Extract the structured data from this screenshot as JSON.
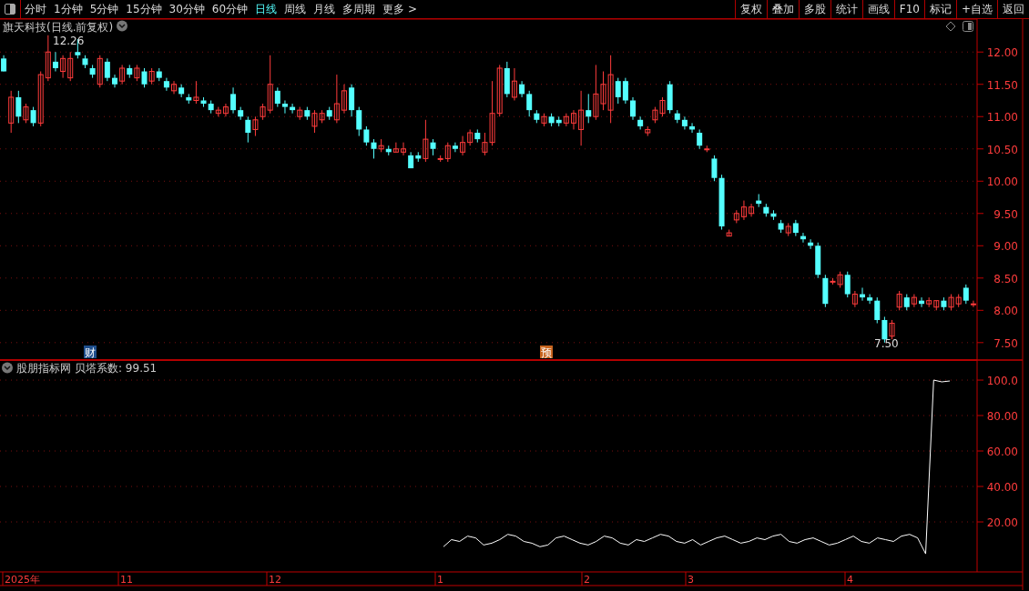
{
  "toolbar": {
    "tabs": [
      {
        "label": "分时",
        "selected": false
      },
      {
        "label": "1分钟",
        "selected": false
      },
      {
        "label": "5分钟",
        "selected": false
      },
      {
        "label": "15分钟",
        "selected": false
      },
      {
        "label": "30分钟",
        "selected": false
      },
      {
        "label": "60分钟",
        "selected": false
      },
      {
        "label": "日线",
        "selected": true
      },
      {
        "label": "周线",
        "selected": false
      },
      {
        "label": "月线",
        "selected": false
      },
      {
        "label": "多周期",
        "selected": false
      }
    ],
    "more": "更多 >",
    "buttons": [
      "复权",
      "叠加",
      "多股",
      "统计",
      "画线",
      "F10",
      "标记",
      "+自选",
      "返回"
    ]
  },
  "main_chart": {
    "title": "旗天科技(日线.前复权)",
    "high_label": "12.26",
    "low_label": "7.50",
    "badges": [
      {
        "label": "财",
        "color": "#1f4e8c"
      },
      {
        "label": "预",
        "color": "#c8641e"
      }
    ],
    "chart_data": {
      "type": "candlestick",
      "grid": true,
      "ylim": [
        7.23,
        12.51
      ],
      "yticks": [
        {
          "value": 12,
          "label": "12.00"
        },
        {
          "value": 11.5,
          "label": "11.50"
        },
        {
          "value": 11,
          "label": "11.00"
        },
        {
          "value": 10.5,
          "label": "10.50"
        },
        {
          "value": 10,
          "label": "10.00"
        },
        {
          "value": 9.5,
          "label": "9.50"
        },
        {
          "value": 9,
          "label": "9.00"
        },
        {
          "value": 8.5,
          "label": "8.50"
        },
        {
          "value": 8,
          "label": "8.00"
        },
        {
          "value": 7.5,
          "label": "7.50"
        }
      ],
      "ohlc": [
        [
          11.9,
          11.95,
          11.7,
          11.7
        ],
        [
          10.9,
          11.4,
          10.75,
          11.3
        ],
        [
          11.3,
          11.4,
          10.9,
          11.0
        ],
        [
          10.95,
          11.2,
          10.9,
          11.15
        ],
        [
          11.1,
          11.15,
          10.85,
          10.9
        ],
        [
          10.9,
          11.7,
          10.85,
          11.65
        ],
        [
          11.6,
          12.26,
          11.55,
          12.0
        ],
        [
          11.85,
          12.0,
          11.7,
          11.75
        ],
        [
          11.7,
          11.95,
          11.6,
          11.9
        ],
        [
          11.6,
          12.0,
          11.55,
          11.9
        ],
        [
          12.0,
          12.2,
          11.9,
          11.95
        ],
        [
          11.9,
          11.95,
          11.75,
          11.8
        ],
        [
          11.75,
          11.8,
          11.6,
          11.65
        ],
        [
          11.5,
          11.95,
          11.45,
          11.9
        ],
        [
          11.85,
          11.9,
          11.55,
          11.6
        ],
        [
          11.6,
          11.65,
          11.45,
          11.5
        ],
        [
          11.55,
          11.8,
          11.5,
          11.75
        ],
        [
          11.75,
          11.8,
          11.6,
          11.65
        ],
        [
          11.6,
          11.8,
          11.55,
          11.75
        ],
        [
          11.7,
          11.75,
          11.45,
          11.5
        ],
        [
          11.55,
          11.75,
          11.5,
          11.7
        ],
        [
          11.7,
          11.75,
          11.55,
          11.6
        ],
        [
          11.55,
          11.6,
          11.4,
          11.45
        ],
        [
          11.4,
          11.55,
          11.35,
          11.5
        ],
        [
          11.45,
          11.5,
          11.3,
          11.35
        ],
        [
          11.3,
          11.35,
          11.2,
          11.25
        ],
        [
          11.25,
          11.55,
          11.2,
          11.3
        ],
        [
          11.25,
          11.3,
          11.15,
          11.2
        ],
        [
          11.2,
          11.25,
          11.05,
          11.1
        ],
        [
          11.05,
          11.15,
          11.0,
          11.1
        ],
        [
          11.05,
          11.2,
          11.0,
          11.15
        ],
        [
          11.35,
          11.45,
          11.05,
          11.1
        ],
        [
          11.1,
          11.15,
          10.95,
          11.0
        ],
        [
          10.95,
          11.0,
          10.6,
          10.75
        ],
        [
          10.8,
          11.0,
          10.7,
          10.95
        ],
        [
          11.0,
          11.2,
          10.95,
          11.15
        ],
        [
          11.1,
          11.95,
          11.05,
          11.5
        ],
        [
          11.4,
          11.45,
          11.15,
          11.2
        ],
        [
          11.2,
          11.25,
          11.05,
          11.15
        ],
        [
          11.15,
          11.2,
          11.05,
          11.1
        ],
        [
          11.0,
          11.15,
          10.95,
          11.1
        ],
        [
          11.1,
          11.15,
          10.95,
          11.0
        ],
        [
          10.85,
          11.1,
          10.75,
          11.05
        ],
        [
          10.95,
          11.1,
          10.9,
          11.05
        ],
        [
          11.1,
          11.15,
          10.95,
          11.0
        ],
        [
          10.95,
          11.65,
          10.9,
          11.2
        ],
        [
          11.1,
          11.5,
          11.05,
          11.4
        ],
        [
          11.45,
          11.5,
          11.0,
          11.1
        ],
        [
          11.1,
          11.15,
          10.7,
          10.8
        ],
        [
          10.8,
          10.85,
          10.55,
          10.6
        ],
        [
          10.6,
          10.65,
          10.35,
          10.5
        ],
        [
          10.5,
          10.65,
          10.45,
          10.55
        ],
        [
          10.5,
          10.55,
          10.4,
          10.45
        ],
        [
          10.45,
          10.6,
          10.45,
          10.5
        ],
        [
          10.45,
          10.6,
          10.4,
          10.5
        ],
        [
          10.4,
          10.45,
          10.2,
          10.2
        ],
        [
          10.4,
          10.45,
          10.3,
          10.35
        ],
        [
          10.35,
          10.95,
          10.3,
          10.65
        ],
        [
          10.6,
          10.65,
          10.4,
          10.5
        ],
        [
          10.35,
          10.4,
          10.3,
          10.35
        ],
        [
          10.35,
          10.6,
          10.3,
          10.55
        ],
        [
          10.55,
          10.6,
          10.45,
          10.5
        ],
        [
          10.45,
          10.7,
          10.4,
          10.6
        ],
        [
          10.6,
          10.8,
          10.55,
          10.75
        ],
        [
          10.75,
          10.8,
          10.6,
          10.65
        ],
        [
          10.45,
          10.75,
          10.4,
          10.6
        ],
        [
          10.6,
          11.55,
          10.55,
          11.05
        ],
        [
          11.05,
          11.8,
          11.0,
          11.75
        ],
        [
          11.75,
          11.85,
          11.3,
          11.35
        ],
        [
          11.3,
          11.75,
          11.25,
          11.55
        ],
        [
          11.5,
          11.55,
          11.3,
          11.35
        ],
        [
          11.35,
          11.4,
          11.0,
          11.1
        ],
        [
          11.05,
          11.1,
          10.9,
          10.95
        ],
        [
          10.9,
          11.05,
          10.85,
          11.0
        ],
        [
          11.0,
          11.05,
          10.85,
          10.9
        ],
        [
          10.95,
          11.0,
          10.85,
          10.9
        ],
        [
          10.9,
          11.05,
          10.85,
          11.0
        ],
        [
          10.9,
          11.1,
          10.8,
          11.05
        ],
        [
          10.8,
          11.4,
          10.55,
          11.1
        ],
        [
          11.1,
          11.35,
          10.9,
          11.0
        ],
        [
          11.0,
          11.8,
          10.95,
          11.35
        ],
        [
          11.2,
          11.7,
          11.1,
          11.5
        ],
        [
          11.1,
          11.95,
          10.9,
          11.65
        ],
        [
          11.55,
          11.6,
          11.2,
          11.3
        ],
        [
          11.55,
          11.6,
          11.2,
          11.25
        ],
        [
          11.25,
          11.3,
          10.95,
          11.0
        ],
        [
          10.95,
          11.0,
          10.8,
          10.85
        ],
        [
          10.75,
          10.85,
          10.7,
          10.8
        ],
        [
          10.95,
          11.15,
          10.9,
          11.1
        ],
        [
          11.05,
          11.3,
          11.0,
          11.25
        ],
        [
          11.5,
          11.55,
          11.05,
          11.1
        ],
        [
          11.05,
          11.1,
          10.9,
          10.95
        ],
        [
          10.95,
          11.0,
          10.8,
          10.85
        ],
        [
          10.85,
          10.9,
          10.75,
          10.8
        ],
        [
          10.75,
          10.8,
          10.5,
          10.55
        ],
        [
          10.5,
          10.55,
          10.45,
          10.5
        ],
        [
          10.35,
          10.4,
          10.0,
          10.05
        ],
        [
          10.05,
          10.1,
          9.25,
          9.3
        ],
        [
          9.15,
          9.25,
          9.15,
          9.2
        ],
        [
          9.4,
          9.55,
          9.35,
          9.5
        ],
        [
          9.45,
          9.7,
          9.4,
          9.6
        ],
        [
          9.5,
          9.65,
          9.45,
          9.6
        ],
        [
          9.7,
          9.8,
          9.6,
          9.65
        ],
        [
          9.6,
          9.65,
          9.45,
          9.5
        ],
        [
          9.5,
          9.55,
          9.4,
          9.45
        ],
        [
          9.35,
          9.4,
          9.2,
          9.25
        ],
        [
          9.2,
          9.35,
          9.15,
          9.3
        ],
        [
          9.35,
          9.4,
          9.15,
          9.2
        ],
        [
          9.15,
          9.2,
          9.05,
          9.1
        ],
        [
          9.05,
          9.1,
          8.95,
          9.0
        ],
        [
          9.0,
          9.05,
          8.5,
          8.55
        ],
        [
          8.5,
          8.55,
          8.05,
          8.1
        ],
        [
          8.45,
          8.5,
          8.4,
          8.45
        ],
        [
          8.4,
          8.6,
          8.35,
          8.55
        ],
        [
          8.55,
          8.6,
          8.2,
          8.25
        ],
        [
          8.1,
          8.3,
          8.05,
          8.25
        ],
        [
          8.25,
          8.35,
          8.15,
          8.2
        ],
        [
          8.2,
          8.25,
          8.1,
          8.15
        ],
        [
          8.15,
          8.2,
          7.8,
          7.85
        ],
        [
          7.85,
          7.9,
          7.5,
          7.55
        ],
        [
          7.6,
          7.85,
          7.55,
          7.8
        ],
        [
          8.05,
          8.3,
          8.0,
          8.25
        ],
        [
          8.2,
          8.25,
          8.0,
          8.05
        ],
        [
          8.1,
          8.25,
          8.05,
          8.2
        ],
        [
          8.15,
          8.2,
          8.05,
          8.1
        ],
        [
          8.1,
          8.2,
          8.05,
          8.15
        ],
        [
          8.05,
          8.15,
          8.0,
          8.15
        ],
        [
          8.15,
          8.2,
          8.0,
          8.05
        ],
        [
          8.05,
          8.25,
          8.0,
          8.2
        ],
        [
          8.1,
          8.25,
          8.05,
          8.2
        ],
        [
          8.35,
          8.4,
          8.1,
          8.15
        ],
        [
          8.1,
          8.15,
          8.05,
          8.1
        ]
      ]
    }
  },
  "indicator": {
    "name": "股朋指标网",
    "reading": "贝塔系数: 99.51",
    "chart_data": {
      "type": "line",
      "grid": true,
      "ylim": [
        -8.2,
        111.3
      ],
      "yticks": [
        {
          "value": 100,
          "label": "100.0"
        },
        {
          "value": 80,
          "label": "80.00"
        },
        {
          "value": 60,
          "label": "60.00"
        },
        {
          "value": 40,
          "label": "40.00"
        },
        {
          "value": 20,
          "label": "20.00"
        }
      ],
      "series": [
        {
          "color": "#ffffff",
          "values": [
            6,
            10,
            9,
            12,
            11,
            7,
            8,
            10,
            13,
            12,
            9,
            8,
            6,
            7,
            11,
            12,
            10,
            8,
            7,
            9,
            12,
            11,
            8,
            7,
            10,
            9,
            11,
            13,
            12,
            9,
            8,
            10,
            7,
            9,
            11,
            12,
            10,
            8,
            9,
            11,
            10,
            12,
            13,
            9,
            8,
            10,
            11,
            9,
            7,
            8,
            10,
            12,
            9,
            8,
            11,
            10,
            9,
            12,
            13,
            11,
            2,
            100,
            99,
            99.5
          ]
        }
      ]
    }
  },
  "time_axis": [
    "2025年",
    "11",
    "12",
    "1",
    "2",
    "3",
    "4"
  ]
}
